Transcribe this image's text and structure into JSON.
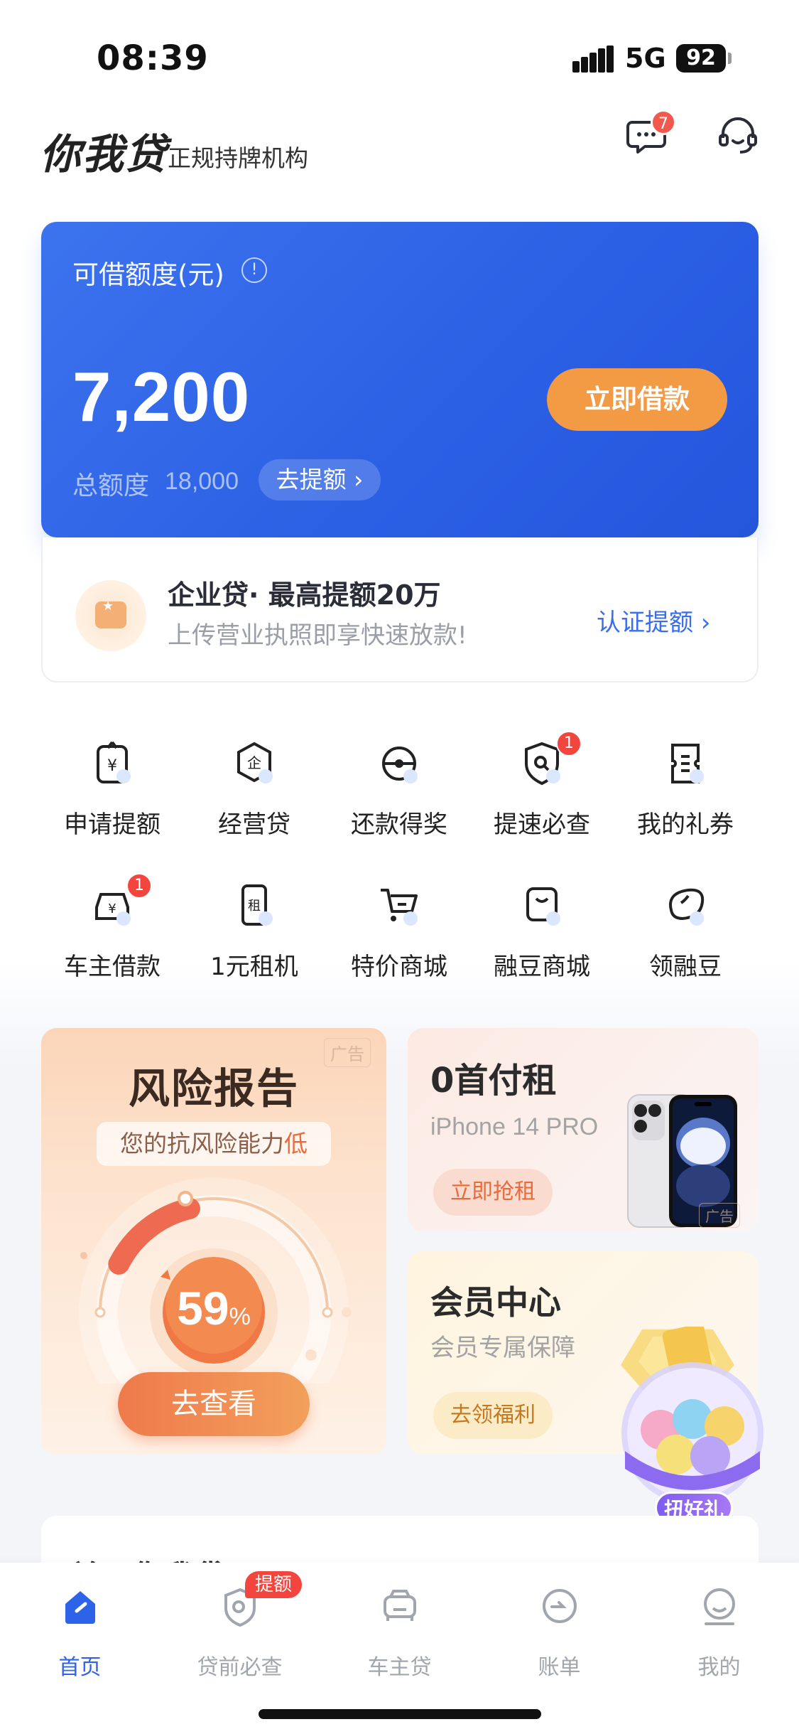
{
  "status_bar": {
    "time": "08:39",
    "network": "5G",
    "battery": "92"
  },
  "header": {
    "brand": "你我贷",
    "subtitle": "正规持牌机构",
    "message_count": "7"
  },
  "credit": {
    "label": "可借额度(元)",
    "amount": "7,200",
    "borrow_label": "立即借款",
    "total_label": "总额度",
    "total_value": "18,000",
    "raise_label": "去提额 ›"
  },
  "enterprise": {
    "title": "企业贷· 最高提额20万",
    "subtitle": "上传营业执照即享快速放款!",
    "link": "认证提额 ›"
  },
  "grid": [
    {
      "label": "申请提额",
      "icon": "yuan-upload-icon"
    },
    {
      "label": "经营贷",
      "icon": "enterprise-hexagon-icon"
    },
    {
      "label": "还款得奖",
      "icon": "repay-reward-icon"
    },
    {
      "label": "提速必查",
      "icon": "shield-search-icon",
      "badge": "1"
    },
    {
      "label": "我的礼券",
      "icon": "coupon-icon"
    },
    {
      "label": "车主借款",
      "icon": "car-yuan-icon",
      "badge": "1"
    },
    {
      "label": "1元租机",
      "icon": "phone-rent-icon",
      "glyph": "租"
    },
    {
      "label": "特价商城",
      "icon": "cart-icon"
    },
    {
      "label": "融豆商城",
      "icon": "bag-icon"
    },
    {
      "label": "领融豆",
      "icon": "bean-icon"
    }
  ],
  "risk": {
    "ad": "广告",
    "title": "风险报告",
    "tag_prefix": "您的抗风险能力",
    "tag_level": "低",
    "percent": "59",
    "percent_unit": "%",
    "percent_value": 59,
    "button": "去查看"
  },
  "rent": {
    "title": "0首付租",
    "subtitle": "iPhone 14 PRO",
    "button": "立即抢租",
    "ad": "广告"
  },
  "member": {
    "title": "会员中心",
    "subtitle": "会员专属保障",
    "button": "去领福利"
  },
  "gacha": {
    "label": "扭好礼"
  },
  "about": {
    "title": "关于你我贷"
  },
  "tabs": [
    {
      "label": "首页",
      "icon": "home-icon",
      "active": true
    },
    {
      "label": "贷前必查",
      "icon": "shield-check-icon",
      "badge": "提额"
    },
    {
      "label": "车主贷",
      "icon": "car-icon"
    },
    {
      "label": "账单",
      "icon": "bill-icon"
    },
    {
      "label": "我的",
      "icon": "profile-icon"
    }
  ],
  "colors": {
    "primary": "#2c63e9",
    "accent_orange": "#f29a44",
    "badge_red": "#f2453d"
  }
}
